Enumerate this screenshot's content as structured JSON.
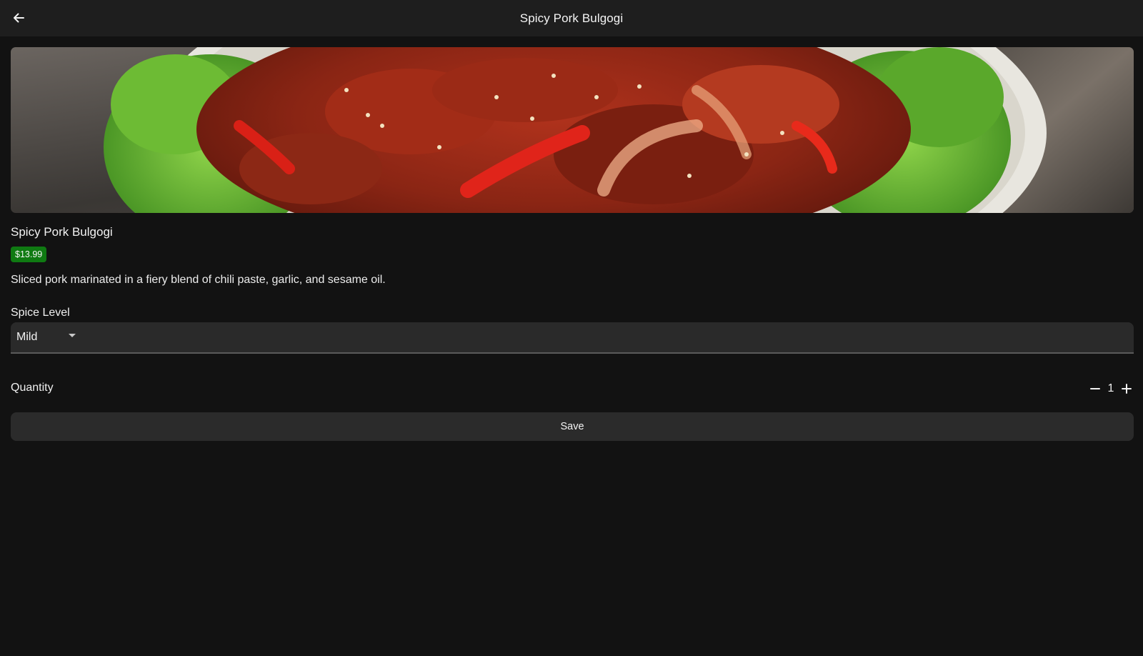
{
  "app_bar": {
    "title": "Spicy Pork Bulgogi",
    "back_icon": "arrow-left-icon"
  },
  "hero_image": {
    "alt": "Spicy pork bulgogi with red peppers and lettuce on a plate"
  },
  "dish": {
    "name": "Spicy Pork Bulgogi",
    "price": "$13.99",
    "description": "Sliced pork marinated in a fiery blend of chili paste, garlic, and sesame oil."
  },
  "spice_level": {
    "label": "Spice Level",
    "value": "Mild",
    "caret_icon": "caret-down-icon"
  },
  "quantity": {
    "label": "Quantity",
    "value": "1",
    "minus_icon": "minus-icon",
    "plus_icon": "plus-icon"
  },
  "actions": {
    "save_label": "Save"
  },
  "colors": {
    "background": "#121212",
    "app_bar": "#1e1e1e",
    "price_badge": "#0f7a12",
    "surface": "#2a2a2a"
  }
}
